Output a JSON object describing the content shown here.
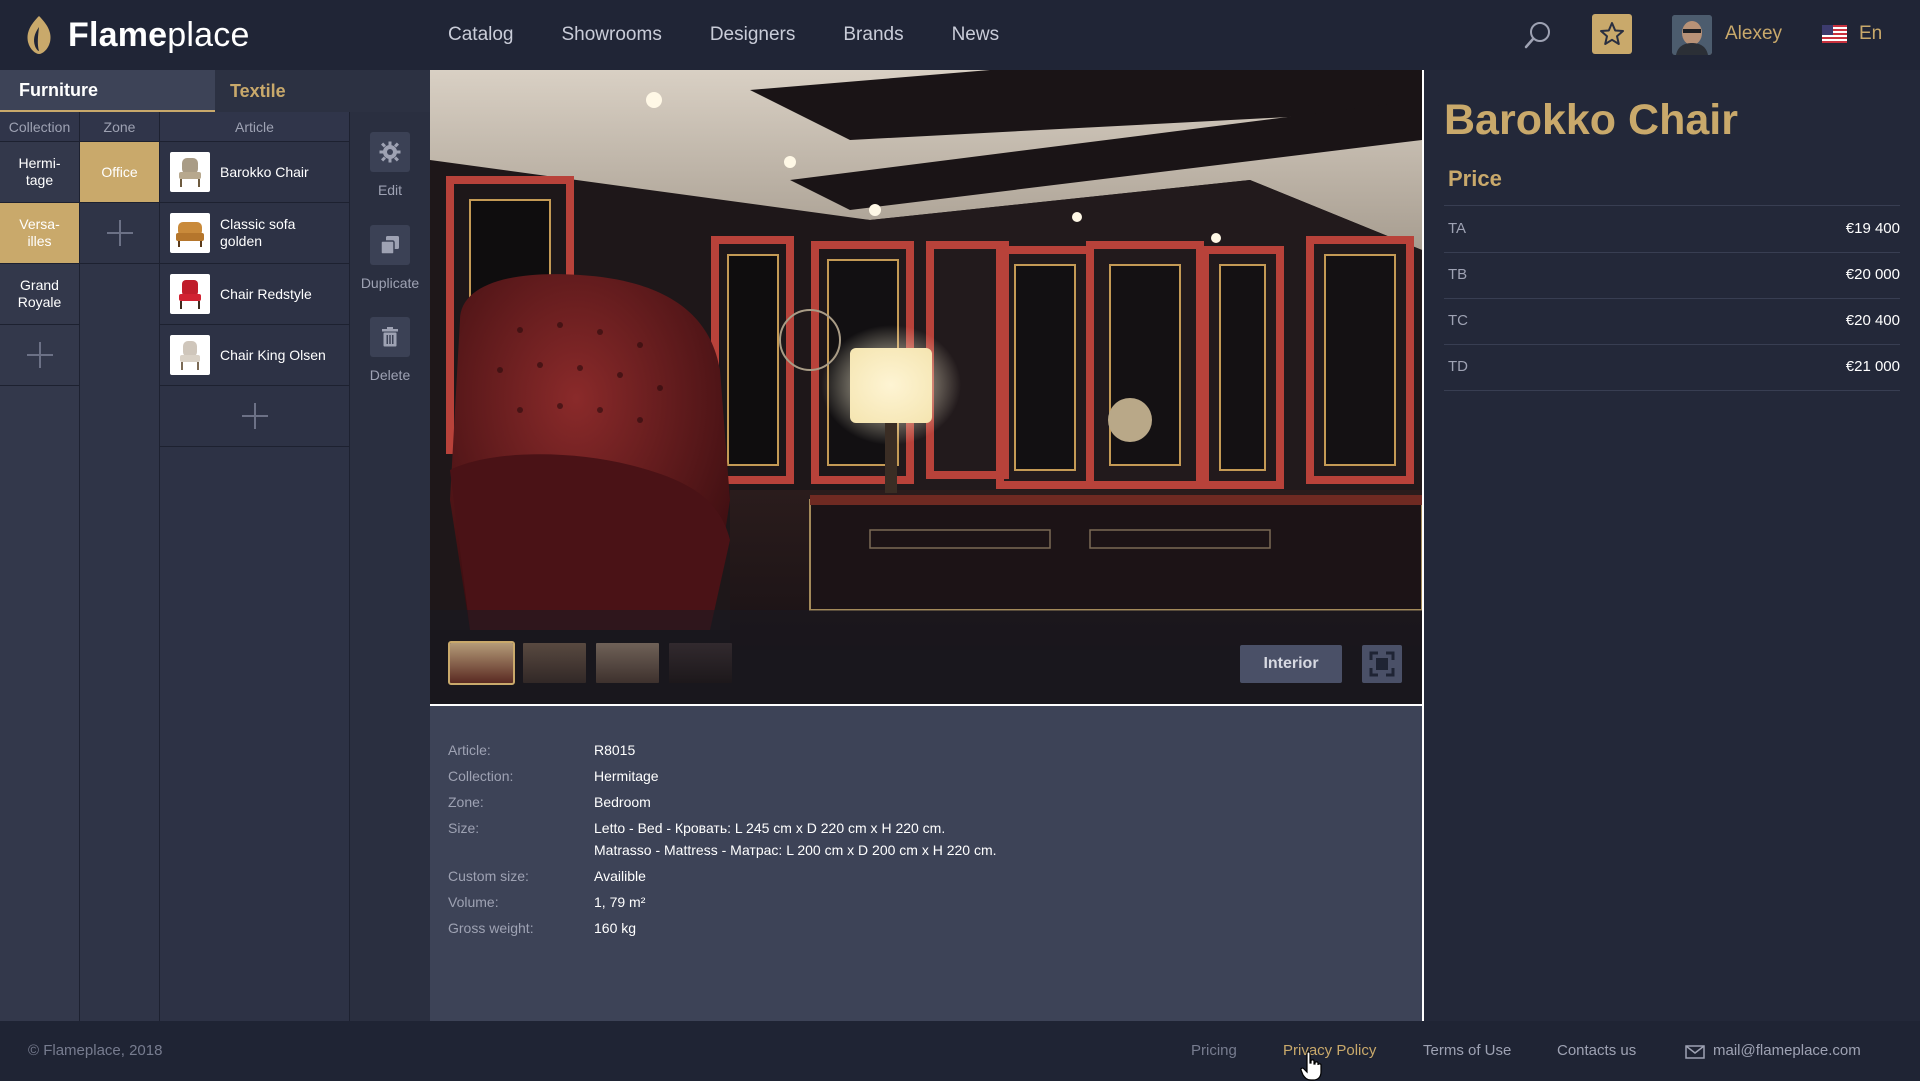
{
  "header": {
    "logo_bold": "Flame",
    "logo_light": "place",
    "nav": [
      "Catalog",
      "Showrooms",
      "Designers",
      "Brands",
      "News"
    ],
    "user_name": "Alexey",
    "language": "En"
  },
  "left": {
    "tabs": [
      "Furniture",
      "Textile"
    ],
    "columns": {
      "collection": "Collection",
      "zone": "Zone",
      "article": "Article"
    },
    "collections": [
      "Hermi-\ntage",
      "Versa-\nilles",
      "Grand\nRoyale"
    ],
    "selected_collection": "Versa-\nilles",
    "zones": [
      "Office"
    ],
    "articles": [
      "Barokko Chair",
      "Classic sofa\ngolden",
      "Chair Redstyle",
      "Chair King Olsen"
    ],
    "actions": [
      "Edit",
      "Duplicate",
      "Delete"
    ]
  },
  "viewer": {
    "mode_button": "Interior"
  },
  "details": {
    "rows": [
      {
        "key": "Article:",
        "value": "R8015"
      },
      {
        "key": "Collection:",
        "value": "Hermitage"
      },
      {
        "key": "Zone:",
        "value": "Bedroom"
      },
      {
        "key": "Size:",
        "value": "Letto - Bed - Кровать: L 245 cm x D 220 cm x H 220 cm."
      },
      {
        "key": "",
        "value": "Matrasso - Mattress - Матрас: L 200 cm x D 200 cm x H 220 cm."
      },
      {
        "key": "Custom size:",
        "value": "Availible"
      },
      {
        "key": "Volume:",
        "value": "1, 79 m²"
      },
      {
        "key": "Gross weight:",
        "value": "160 kg"
      }
    ]
  },
  "product": {
    "title": "Barokko Chair",
    "price_heading": "Price",
    "prices": [
      {
        "tier": "TA",
        "value": "€19 400"
      },
      {
        "tier": "TB",
        "value": "€20 000"
      },
      {
        "tier": "TC",
        "value": "€20 400"
      },
      {
        "tier": "TD",
        "value": "€21 000"
      }
    ]
  },
  "footer": {
    "copyright": "© Flameplace, 2018",
    "links": [
      "Pricing",
      "Privacy Policy",
      "Terms of Use",
      "Contacts us"
    ],
    "email": "mail@flameplace.com"
  },
  "colors": {
    "accent": "#c9a96b",
    "background": "#232839",
    "panel": "#3d4357"
  },
  "icons": [
    "search-icon",
    "star-icon",
    "flag-icon",
    "gear-icon",
    "duplicate-icon",
    "trash-icon",
    "fullscreen-icon",
    "mail-icon",
    "plus-icon"
  ]
}
